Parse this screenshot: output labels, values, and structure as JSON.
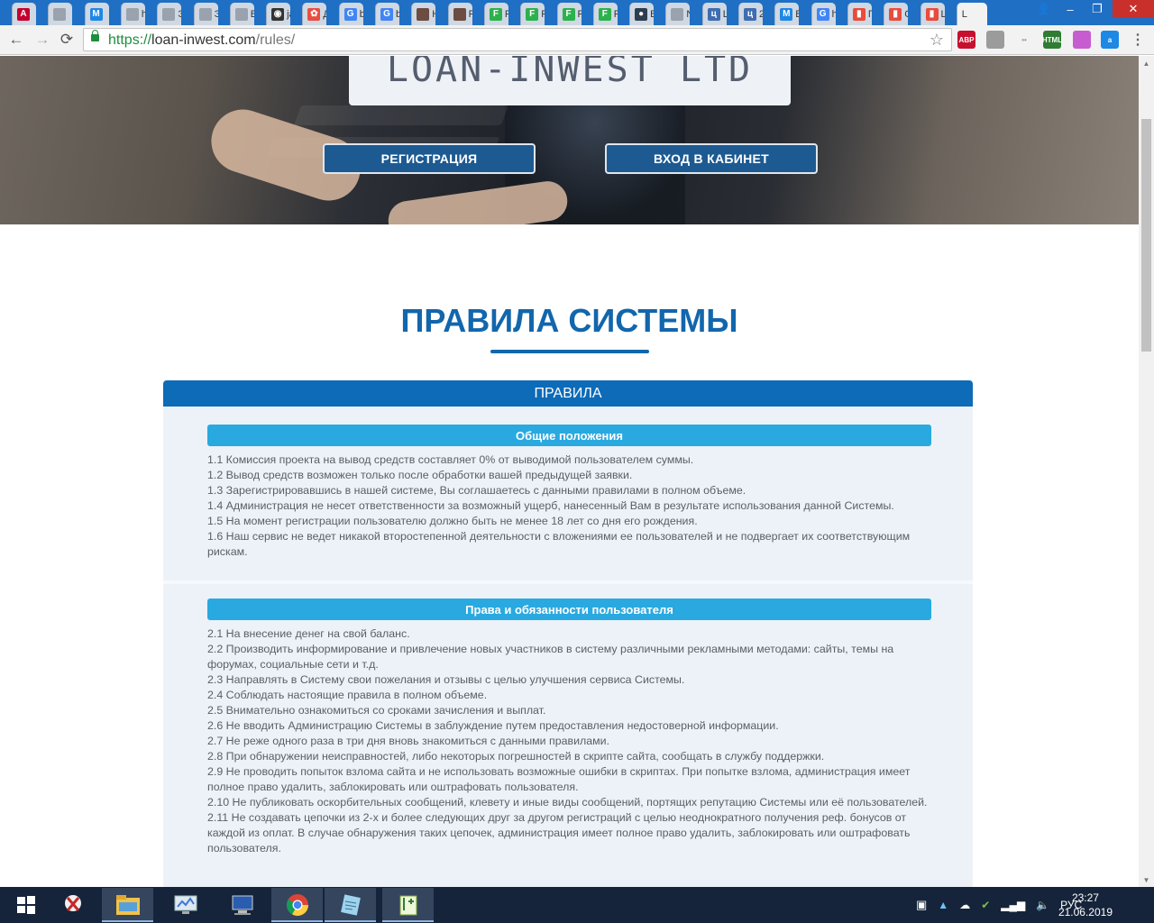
{
  "browser": {
    "tabs": [
      {
        "icon": "angular-icon",
        "label": "",
        "color": "#c3002f",
        "glyph": "A"
      },
      {
        "icon": "page-icon",
        "label": "",
        "color": "#9aa3ad",
        "glyph": ""
      },
      {
        "icon": "m-icon",
        "label": "",
        "color": "#1e88e5",
        "glyph": "M"
      },
      {
        "icon": "page-icon",
        "label": "h",
        "color": "#9aa3ad",
        "glyph": ""
      },
      {
        "icon": "page-icon",
        "label": "Э",
        "color": "#9aa3ad",
        "glyph": ""
      },
      {
        "icon": "page-icon",
        "label": "Э",
        "color": "#9aa3ad",
        "glyph": ""
      },
      {
        "icon": "page-icon",
        "label": "Б",
        "color": "#9aa3ad",
        "glyph": ""
      },
      {
        "icon": "glasses-icon",
        "label": "ja",
        "color": "#333333",
        "glyph": "◉"
      },
      {
        "icon": "flower-icon",
        "label": "Д",
        "color": "#e84e40",
        "glyph": "✿"
      },
      {
        "icon": "google-icon",
        "label": "b",
        "color": "#4285f4",
        "glyph": "G"
      },
      {
        "icon": "google-icon",
        "label": "b",
        "color": "#4285f4",
        "glyph": "G"
      },
      {
        "icon": "photo-icon",
        "label": "Н",
        "color": "#6d4c41",
        "glyph": ""
      },
      {
        "icon": "photo-icon",
        "label": "F",
        "color": "#6d4c41",
        "glyph": ""
      },
      {
        "icon": "f-icon",
        "label": "F",
        "color": "#2bb24c",
        "glyph": "F"
      },
      {
        "icon": "f-icon",
        "label": "F",
        "color": "#2bb24c",
        "glyph": "F"
      },
      {
        "icon": "f-icon",
        "label": "F",
        "color": "#2bb24c",
        "glyph": "F"
      },
      {
        "icon": "f-icon",
        "label": "F",
        "color": "#2bb24c",
        "glyph": "F"
      },
      {
        "icon": "globe-icon",
        "label": "В",
        "color": "#2d3e50",
        "glyph": "●"
      },
      {
        "icon": "page-icon",
        "label": "N",
        "color": "#9aa3ad",
        "glyph": ""
      },
      {
        "icon": "yandex-icon",
        "label": "L",
        "color": "#3f6db0",
        "glyph": "ц"
      },
      {
        "icon": "yandex-icon",
        "label": "2",
        "color": "#3f6db0",
        "glyph": "ц"
      },
      {
        "icon": "m-icon",
        "label": "В",
        "color": "#1e88e5",
        "glyph": "M"
      },
      {
        "icon": "google-icon",
        "label": "h",
        "color": "#4285f4",
        "glyph": "G"
      },
      {
        "icon": "chart-icon",
        "label": "Г",
        "color": "#e94b3c",
        "glyph": "▮"
      },
      {
        "icon": "chart-icon",
        "label": "С",
        "color": "#e94b3c",
        "glyph": "▮"
      },
      {
        "icon": "chart-icon",
        "label": "L",
        "color": "#e94b3c",
        "glyph": "▮"
      },
      {
        "icon": "",
        "label": "L",
        "color": "#f2f2f2",
        "glyph": "",
        "active": true
      }
    ],
    "window_controls": {
      "minimize": "–",
      "maximize": "❐",
      "close": "✕"
    },
    "nav": {
      "back": "←",
      "forward": "→",
      "reload": "⟳"
    },
    "url": {
      "scheme": "https://",
      "host": "loan-inwest.com",
      "path": "/rules/"
    },
    "bookmark_star": "☆",
    "extensions": [
      {
        "name": "adblock-icon",
        "label": "ABP",
        "color": "#c8102e"
      },
      {
        "name": "ghost-icon",
        "label": "",
        "color": "#9b9b9b"
      },
      {
        "name": "more-icon",
        "label": "••",
        "color": "#9b9b9b"
      },
      {
        "name": "html-validator-icon",
        "label": "HTML",
        "color": "#2e7d32"
      },
      {
        "name": "paint-icon",
        "label": "",
        "color": "#c75cd1"
      },
      {
        "name": "account-icon",
        "label": "a",
        "color": "#1e88e5"
      },
      {
        "name": "menu-icon",
        "label": "⋮",
        "color": "#666666"
      }
    ]
  },
  "hero": {
    "logo": "LOAN-INWEST LTD",
    "register_button": "РЕГИСТРАЦИЯ",
    "login_button": "ВХОД В КАБИНЕТ"
  },
  "page": {
    "title": "ПРАВИЛА СИСТЕМЫ",
    "panel_title": "ПРАВИЛА",
    "sections": [
      {
        "heading": "Общие положения",
        "items": [
          "1.1 Комиссия проекта на вывод средств составляет 0% от выводимой пользователем суммы.",
          "1.2 Вывод средств возможен только после обработки вашей предыдущей заявки.",
          "1.3 Зарегистрировавшись в нашей системе, Вы соглашаетесь с данными правилами в полном объеме.",
          "1.4 Администрация не несет ответственности за возможный ущерб, нанесенный Вам в результате использования данной Системы.",
          "1.5 На момент регистрации пользователю должно быть не менее 18 лет со дня его рождения.",
          "1.6 Наш сервис не ведет никакой второстепенной деятельности с вложениями ее пользователей и не подвергает их соответствующим рискам."
        ]
      },
      {
        "heading": "Права и обязанности пользователя",
        "items": [
          "2.1 На внесение денег на свой баланс.",
          "2.2 Производить информирование и привлечение новых участников в систему различными рекламными методами: сайты, темы на форумах, социальные сети и т.д.",
          "2.3 Направлять в Систему свои пожелания и отзывы с целью улучшения сервиса Системы.",
          "2.4 Соблюдать настоящие правила в полном объеме.",
          "2.5 Внимательно ознакомиться со сроками зачисления и выплат.",
          "2.6 Не вводить Администрацию Системы в заблуждение путем предоставления недостоверной информации.",
          "2.7 Не реже одного раза в три дня вновь знакомиться с данными правилами.",
          "2.8 При обнаружении неисправностей, либо некоторых погрешностей в скрипте сайта, сообщать в службу поддержки.",
          "2.9 Не проводить попыток взлома сайта и не использовать возможные ошибки в скриптах. При попытке взлома, администрация имеет полное право удалить, заблокировать или оштрафовать пользователя.",
          "2.10 Не публиковать оскорбительных сообщений, клевету и иные виды сообщений, портящих репутацию Системы или её пользователей.",
          "2.11 Не создавать цепочки из 2-х и более следующих друг за другом регистраций с целью неоднократного получения реф. бонусов от каждой из оплат. В случае обнаружения таких цепочек, администрация имеет полное право удалить, заблокировать или оштрафовать пользователя."
        ]
      }
    ]
  },
  "taskbar": {
    "apps": [
      {
        "name": "start-button",
        "icon": "windows-icon"
      },
      {
        "name": "taskbar-app-snipping",
        "icon": "scissors-icon"
      },
      {
        "name": "taskbar-app-explorer",
        "icon": "folder-icon"
      },
      {
        "name": "taskbar-app-monitor",
        "icon": "monitor-icon"
      },
      {
        "name": "taskbar-app-computer",
        "icon": "computer-icon"
      },
      {
        "name": "taskbar-app-chrome",
        "icon": "chrome-icon"
      },
      {
        "name": "taskbar-app-notes",
        "icon": "notepad-icon"
      },
      {
        "name": "taskbar-app-notepadpp",
        "icon": "notepadpp-icon"
      }
    ],
    "language": "РУС",
    "time": "23:27",
    "date": "21.06.2019"
  },
  "colors": {
    "brand_blue": "#1266ac",
    "panel_header": "#0d6bb8",
    "section_header": "#29a9e0",
    "panel_bg": "#ecf2f8",
    "hero_button": "#1d5a92"
  }
}
